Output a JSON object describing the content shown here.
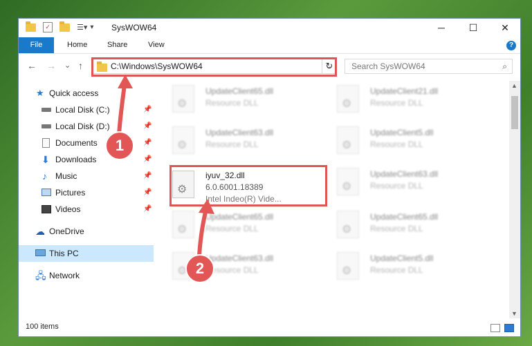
{
  "window": {
    "title": "SysWOW64"
  },
  "ribbon": {
    "file": "File",
    "home": "Home",
    "share": "Share",
    "view": "View"
  },
  "nav": {
    "back": "←",
    "forward": "→",
    "recent": "⌄",
    "up": "↑"
  },
  "address": {
    "path": "C:\\Windows\\SysWOW64"
  },
  "search": {
    "placeholder": "Search SysWOW64"
  },
  "sidebar": {
    "items": [
      {
        "label": "Quick access",
        "icon": "star-icon"
      },
      {
        "label": "Local Disk (C:)",
        "icon": "drive-icon"
      },
      {
        "label": "Local Disk (D:)",
        "icon": "drive-icon"
      },
      {
        "label": "Documents",
        "icon": "documents-icon"
      },
      {
        "label": "Downloads",
        "icon": "downloads-icon"
      },
      {
        "label": "Music",
        "icon": "music-icon"
      },
      {
        "label": "Pictures",
        "icon": "pictures-icon"
      },
      {
        "label": "Videos",
        "icon": "videos-icon"
      },
      {
        "label": "OneDrive",
        "icon": "cloud-icon"
      },
      {
        "label": "This PC",
        "icon": "computer-icon"
      },
      {
        "label": "Network",
        "icon": "network-icon"
      }
    ]
  },
  "files": [
    {
      "name": "UpdateClient65.dll",
      "desc": "Resource DLL"
    },
    {
      "name": "UpdateClient21.dll",
      "desc": "Resource DLL"
    },
    {
      "name": "UpdateClient63.dll",
      "desc": "Resource DLL"
    },
    {
      "name": "UpdateClient5.dll",
      "desc": "Resource DLL"
    },
    {
      "name": "iyuv_32.dll",
      "version": "6.0.6001.18389",
      "desc": "Intel Indeo(R) Vide..."
    },
    {
      "name": "UpdateClient63.dll",
      "desc": "Resource DLL"
    },
    {
      "name": "UpdateClient65.dll",
      "desc": "Resource DLL"
    },
    {
      "name": "UpdateClient65.dll",
      "desc": "Resource DLL"
    },
    {
      "name": "UpdateClient63.dll",
      "desc": "Resource DLL"
    },
    {
      "name": "UpdateClient5.dll",
      "desc": "Resource DLL"
    }
  ],
  "status": {
    "count": "100 items"
  },
  "annotations": {
    "step1": "1",
    "step2": "2"
  },
  "colors": {
    "accent": "#1979ca",
    "highlight": "#e05454",
    "selected": "#cce8ff"
  }
}
